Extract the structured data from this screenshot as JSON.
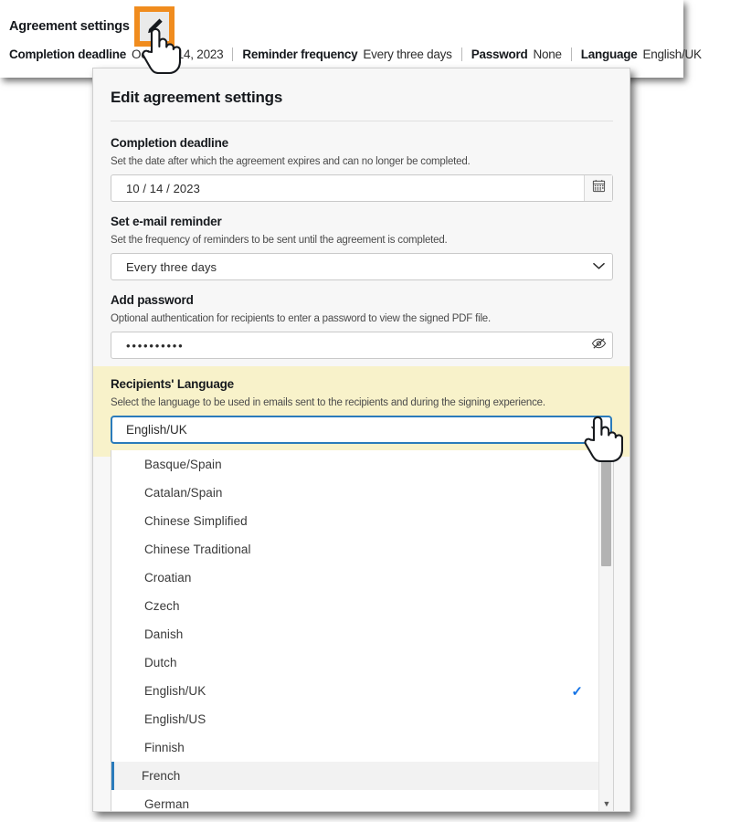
{
  "summary": {
    "title": "Agreement settings",
    "edit_icon": "pencil-icon",
    "fields": [
      {
        "label": "Completion deadline",
        "value": "October 14, 2023"
      },
      {
        "label": "Reminder frequency",
        "value": "Every three days"
      },
      {
        "label": "Password",
        "value": "None"
      },
      {
        "label": "Language",
        "value": "English/UK"
      }
    ]
  },
  "dialog": {
    "title": "Edit agreement settings",
    "deadline": {
      "label": "Completion deadline",
      "description": "Set the date after which the agreement expires and can no longer be completed.",
      "value": "10 / 14 / 2023",
      "icon": "calendar-icon"
    },
    "reminder": {
      "label": "Set e-mail reminder",
      "description": "Set the frequency of reminders to be sent until the agreement is completed.",
      "value": "Every three days",
      "icon": "chevron-down-icon"
    },
    "password": {
      "label": "Add password",
      "description": "Optional authentication for recipients to enter a password to view the signed PDF file.",
      "value": "••••••••••",
      "icon": "eye-off-icon"
    },
    "language": {
      "label": "Recipients' Language",
      "description": "Select the language to be used in emails sent to the recipients and during the signing experience.",
      "value": "English/UK",
      "icon": "chevron-down-icon",
      "options": [
        {
          "label": "Basque/Spain",
          "selected": false,
          "highlighted": false
        },
        {
          "label": "Catalan/Spain",
          "selected": false,
          "highlighted": false
        },
        {
          "label": "Chinese Simplified",
          "selected": false,
          "highlighted": false
        },
        {
          "label": "Chinese Traditional",
          "selected": false,
          "highlighted": false
        },
        {
          "label": "Croatian",
          "selected": false,
          "highlighted": false
        },
        {
          "label": "Czech",
          "selected": false,
          "highlighted": false
        },
        {
          "label": "Danish",
          "selected": false,
          "highlighted": false
        },
        {
          "label": "Dutch",
          "selected": false,
          "highlighted": false
        },
        {
          "label": "English/UK",
          "selected": true,
          "highlighted": false
        },
        {
          "label": "English/US",
          "selected": false,
          "highlighted": false
        },
        {
          "label": "Finnish",
          "selected": false,
          "highlighted": false
        },
        {
          "label": "French",
          "selected": false,
          "highlighted": true
        },
        {
          "label": "German",
          "selected": false,
          "highlighted": false
        }
      ],
      "checkmark": "✓",
      "scroll_down_arrow": "▼"
    }
  },
  "colors": {
    "highlight_box": "#f08c1e",
    "band_background": "#f8f2ca",
    "focus_border": "#2a7bbb",
    "check_blue": "#1473e6"
  }
}
